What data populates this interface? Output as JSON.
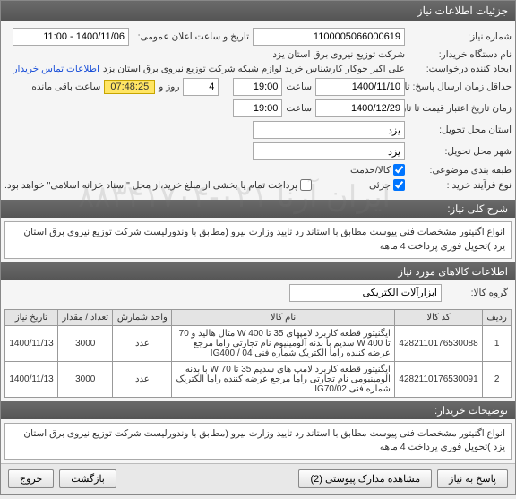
{
  "titlebar": "جزئیات اطلاعات نیاز",
  "labels": {
    "need_no": "شماره نیاز:",
    "announce_dt": "تاریخ و ساعت اعلان عمومی:",
    "buyer_org": "نام دستگاه خریدار:",
    "requester": "ایجاد کننده درخواست:",
    "contact_link": "اطلاعات تماس خریدار",
    "deadline": "حداقل زمان ارسال پاسخ: تا تاریخ:",
    "time_word": "ساعت",
    "expiry": "زمان تاریخ اعتبار قیمت تا تاریخ:",
    "deliver_prov": "استان محل تحویل:",
    "deliver_city": "شهر محل تحویل:",
    "classification": "طبقه بندی موضوعی:",
    "purchase_proc": "نوع فرآیند خرید :",
    "days_word": "روز و",
    "remaining": "ساعت باقی مانده",
    "goods_service": "کالا/خدمت",
    "partial": "جزئی",
    "pay_note": "پرداخت تمام یا بخشی از مبلغ خرید،از محل \"اسناد خزانه اسلامی\" خواهد بود."
  },
  "values": {
    "need_no": "1100005066000619",
    "announce_dt": "1400/11/06 - 11:00",
    "buyer_org": "شرکت توزیع نیروی برق استان یزد",
    "requester": "علی اکبر جوکار  کارشناس خرید لوازم شبکه  شرکت توزیع نیروی برق استان یزد",
    "deadline_date": "1400/11/10",
    "deadline_time": "19:00",
    "days": "4",
    "timer": "07:48:25",
    "expiry_date": "1400/12/29",
    "expiry_time": "19:00",
    "province": "یزد",
    "city": "یزد"
  },
  "checks": {
    "goods": true,
    "partial": true
  },
  "section_general": "شرح کلی نیاز:",
  "general_desc": "انواع اگنیتور مشخصات فنی پیوست مطابق با استاندارد تایید وزارت نیرو (مطابق با وندورلیست شرکت توزیع نیروی برق استان یزد )تحویل فوری پرداخت 4 ماهه",
  "section_items": "اطلاعات کالاهای مورد نیاز",
  "group_label": "گروه کالا:",
  "group_value": "ابزارآلات الکتریکی",
  "columns": [
    "ردیف",
    "کد کالا",
    "نام کالا",
    "واحد شمارش",
    "تعداد / مقدار",
    "تاریخ نیاز"
  ],
  "rows": [
    {
      "idx": "1",
      "code": "4282110176530088",
      "name": "ایگنیتور قطعه کاربرد لامپهای 35 تا W 400 متال هالید و 70 تا 400 W سدیم با بدنه آلومینیوم نام تجارتی راما مرجع عرضه کننده راما الکتریک شماره فنی 04 / IG400",
      "unit": "عدد",
      "qty": "3000",
      "date": "1400/11/13"
    },
    {
      "idx": "2",
      "code": "4282110176530091",
      "name": "ایگنیتور قطعه کاربرد لامپ های سدیم 35 تا 70 W با بدنه آلومینیومی نام تجارتی راما مرجع عرضه کننده راما الکتریک شماره فنی IG70/02",
      "unit": "عدد",
      "qty": "3000",
      "date": "1400/11/13"
    }
  ],
  "section_buyer_notes": "توضیحات خریدار:",
  "buyer_notes": "انواع اگنیتور مشخصات فنی پیوست مطابق با استاندارد تایید وزارت نیرو (مطابق با وندورلیست شرکت توزیع نیروی برق استان یزد )تحویل فوری پرداخت 4 ماهه",
  "footer": {
    "reply": "پاسخ به نیاز",
    "view_attach": "مشاهده مدارک پیوستی (2)",
    "back": "بازگشت",
    "exit": "خروج"
  },
  "watermark": "ایران آرنا\n۰۲۱-۸۸۳۴۱۷۰۴"
}
